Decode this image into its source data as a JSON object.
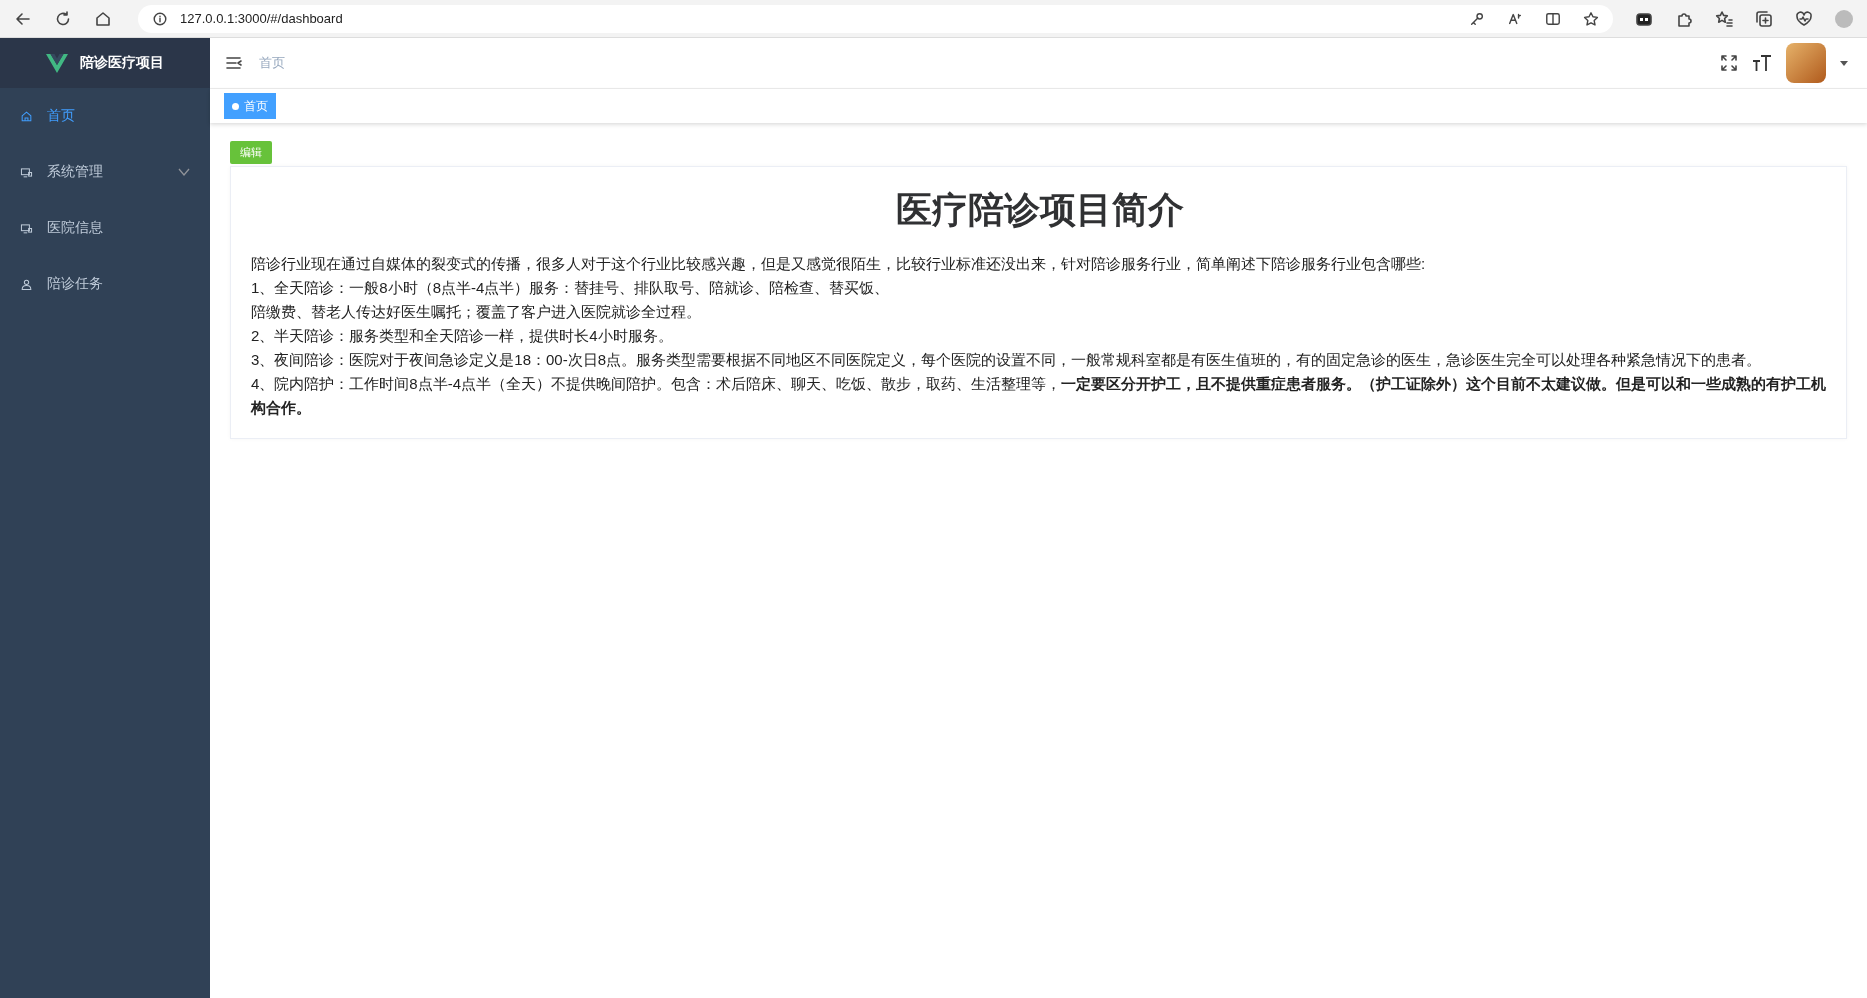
{
  "browser": {
    "url": "127.0.0.1:3000/#/dashboard"
  },
  "sidebar": {
    "logo_title": "陪诊医疗项目",
    "items": [
      {
        "label": "首页",
        "selected": true,
        "kind": "link"
      },
      {
        "label": "系统管理",
        "selected": false,
        "kind": "submenu",
        "expanded": false
      },
      {
        "label": "医院信息",
        "selected": false,
        "kind": "link"
      },
      {
        "label": "陪诊任务",
        "selected": false,
        "kind": "link"
      }
    ]
  },
  "navbar": {
    "breadcrumb": "首页"
  },
  "tags": [
    {
      "label": "首页",
      "selected": true
    }
  ],
  "edit_button": "编辑",
  "article": {
    "title": "医疗陪诊项目简介",
    "paragraphs": [
      "陪诊行业现在通过自媒体的裂变式的传播，很多人对于这个行业比较感兴趣，但是又感觉很陌生，比较行业标准还没出来，针对陪诊服务行业，简单阐述下陪诊服务行业包含哪些:",
      "1、全天陪诊：一般8小时（8点半-4点半）服务：替挂号、排队取号、陪就诊、陪检查、替买饭、",
      "陪缴费、替老人传达好医生嘱托；覆盖了客户进入医院就诊全过程。",
      "2、半天陪诊：服务类型和全天陪诊一样，提供时长4小时服务。",
      "3、夜间陪诊：医院对于夜间急诊定义是18：00-次日8点。服务类型需要根据不同地区不同医院定义，每个医院的设置不同，一般常规科室都是有医生值班的，有的固定急诊的医生，急诊医生完全可以处理各种紧急情况下的患者。",
      "4、院内陪护：工作时间8点半-4点半（全天）不提供晚间陪护。包含：术后陪床、聊天、吃饭、散步，取药、生活整理等，**一定要区分开护工，且不提供重症患者服务。（护工证除外）这个目前不太建议做。但是可以和一些成熟的有护工机构合作。**"
    ]
  }
}
